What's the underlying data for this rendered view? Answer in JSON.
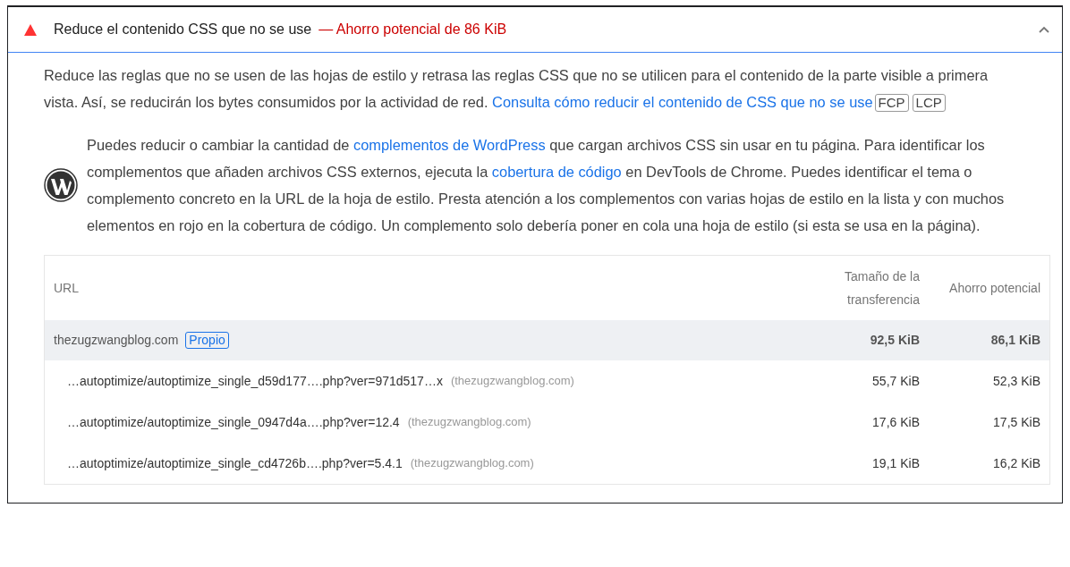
{
  "audit": {
    "failed": true,
    "expanded": true,
    "title": "Reduce el contenido CSS que no se use",
    "savings": "— Ahorro potencial de 86 KiB"
  },
  "description": [
    {
      "kind": "text",
      "text": "Reduce las reglas que no se usen de las hojas de estilo y retrasa las reglas CSS que no se utilicen para el contenido de la parte visible a primera vista. Así, se reducirán los bytes consumidos por la actividad de red. "
    },
    {
      "kind": "link",
      "text": "Consulta cómo reducir el contenido de CSS que no se use"
    },
    {
      "kind": "tag",
      "text": "FCP"
    },
    {
      "kind": "tag",
      "text": "LCP"
    }
  ],
  "stack_tip": [
    {
      "kind": "text",
      "text": "Puedes reducir o cambiar la cantidad de "
    },
    {
      "kind": "link",
      "text": "complementos de WordPress"
    },
    {
      "kind": "text",
      "text": " que cargan archivos CSS sin usar en tu página. Para identificar los complementos que añaden archivos CSS externos, ejecuta la "
    },
    {
      "kind": "link",
      "text": "cobertura de código"
    },
    {
      "kind": "text",
      "text": " en DevTools de Chrome. Puedes identificar el tema o complemento concreto en la URL de la hoja de estilo. Presta atención a los complementos con varias hojas de estilo en la lista y con muchos elementos en rojo en la cobertura de código. Un complemento solo debería poner en cola una hoja de estilo (si esta se usa en la página)."
    }
  ],
  "table": {
    "columns": [
      "URL",
      "Tamaño de la transferencia",
      "Ahorro potencial"
    ],
    "rows": [
      {
        "kind": "group",
        "url": "thezugzwangblog.com",
        "badge": "Propio",
        "transfer": "92,5 KiB",
        "savings": "86,1 KiB"
      },
      {
        "kind": "item",
        "url": "…autoptimize/autoptimize_single_d59d177….php?ver=971d517…x",
        "host": "(thezugzwangblog.com)",
        "transfer": "55,7 KiB",
        "savings": "52,3 KiB"
      },
      {
        "kind": "item",
        "url": "…autoptimize/autoptimize_single_0947d4a….php?ver=12.4",
        "host": "(thezugzwangblog.com)",
        "transfer": "17,6 KiB",
        "savings": "17,5 KiB"
      },
      {
        "kind": "item",
        "url": "…autoptimize/autoptimize_single_cd4726b….php?ver=5.4.1",
        "host": "(thezugzwangblog.com)",
        "transfer": "19,1 KiB",
        "savings": "16,2 KiB"
      }
    ]
  }
}
